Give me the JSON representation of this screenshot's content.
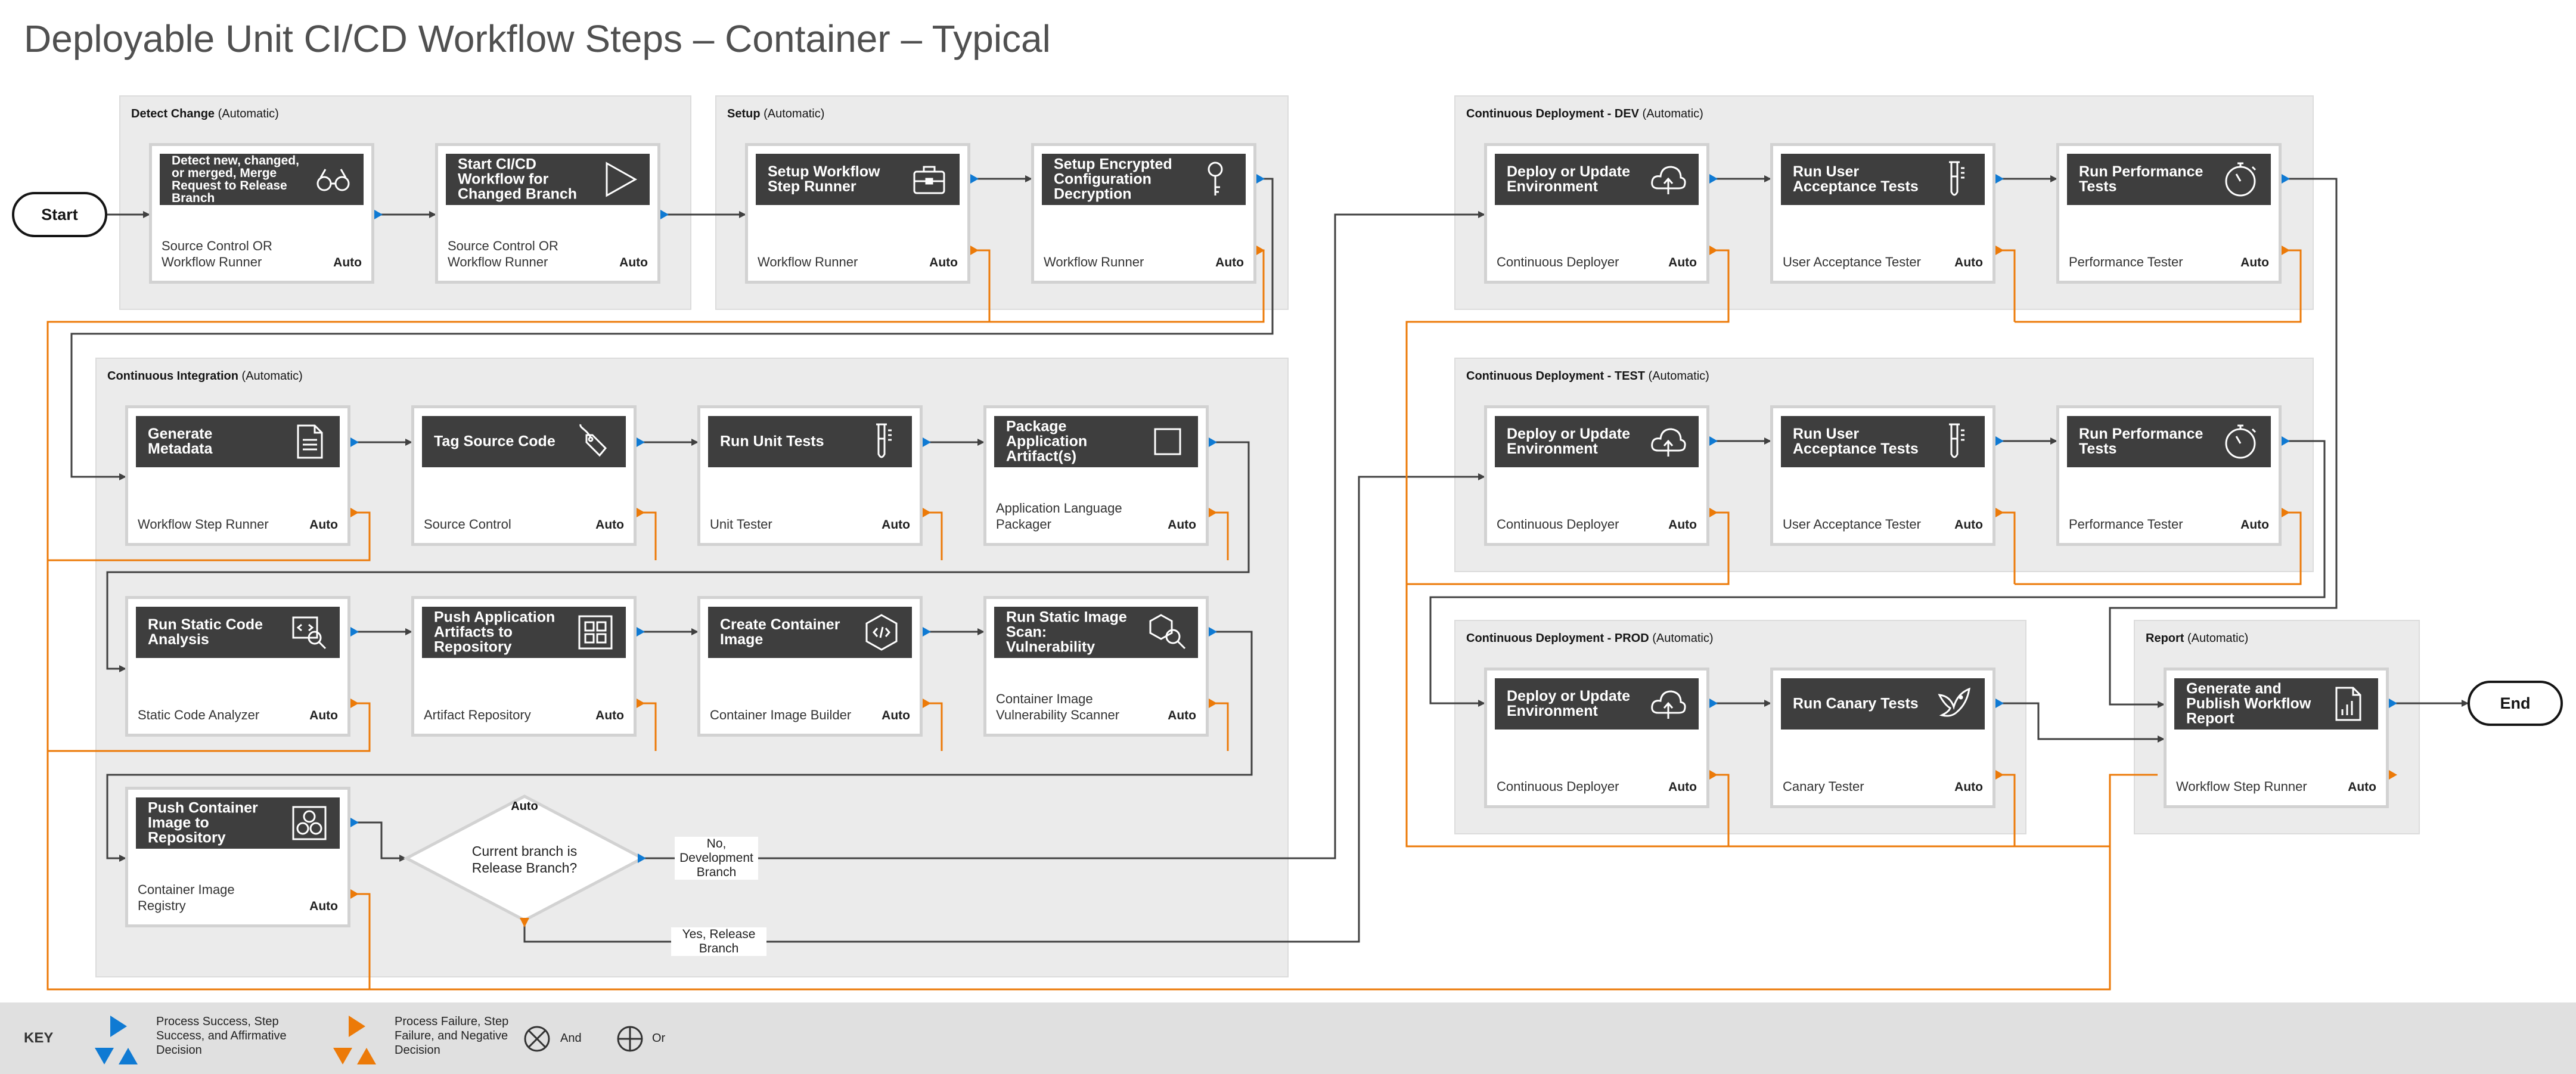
{
  "title": "Deployable Unit CI/CD Workflow Steps – Container – Typical",
  "colors": {
    "success": "#0f7ad3",
    "failure": "#ec7a08",
    "wire": "#404040",
    "panel": "#ebebeb"
  },
  "groups": {
    "detect": {
      "label": "Detect Change",
      "suffix": " (Automatic)"
    },
    "setup": {
      "label": "Setup",
      "suffix": " (Automatic)"
    },
    "ci": {
      "label": "Continuous Integration",
      "suffix": " (Automatic)"
    },
    "cd_dev": {
      "label": "Continuous Deployment - DEV",
      "suffix": " (Automatic)"
    },
    "cd_test": {
      "label": "Continuous Deployment - TEST",
      "suffix": " (Automatic)"
    },
    "cd_prod": {
      "label": "Continuous Deployment - PROD",
      "suffix": " (Automatic)"
    },
    "report": {
      "label": "Report",
      "suffix": " (Automatic)"
    }
  },
  "auto": "Auto",
  "steps": {
    "detect1": {
      "title": "Detect new, changed, or merged, Merge Request to Release Branch",
      "role": "Source Control OR Workflow Runner",
      "icon": "binoculars-icon"
    },
    "detect2": {
      "title": "Start CI/CD Workflow for Changed Branch",
      "role": "Source Control OR Workflow Runner",
      "icon": "play-icon"
    },
    "setup1": {
      "title": "Setup Workflow Step Runner",
      "role": "Workflow Runner",
      "icon": "toolbox-icon"
    },
    "setup2": {
      "title": "Setup Encrypted Configuration Decryption",
      "role": "Workflow Runner",
      "icon": "key-icon"
    },
    "ci1": {
      "title": "Generate Metadata",
      "role": "Workflow Step Runner",
      "icon": "document-icon"
    },
    "ci2": {
      "title": "Tag Source Code",
      "role": "Source Control",
      "icon": "tag-icon"
    },
    "ci3": {
      "title": "Run Unit Tests",
      "role": "Unit Tester",
      "icon": "test-tube-icon"
    },
    "ci4": {
      "title": "Package Application Artifact(s)",
      "role": "Application Language Packager",
      "icon": "package-icon"
    },
    "ci5": {
      "title": "Run Static Code Analysis",
      "role": "Static Code Analyzer",
      "icon": "code-search-icon"
    },
    "ci6": {
      "title": "Push Application Artifacts to Repository",
      "role": "Artifact Repository",
      "icon": "repository-icon"
    },
    "ci7": {
      "title": "Create Container Image",
      "role": "Container Image Builder",
      "icon": "container-hex-icon"
    },
    "ci8": {
      "title": "Run Static Image Scan: Vulnerability",
      "role": "Container Image Vulnerability Scanner",
      "icon": "image-scan-icon"
    },
    "ci9": {
      "title": "Push Container Image to Repository",
      "role": "Container Image Registry",
      "icon": "registry-icon"
    },
    "dev1": {
      "title": "Deploy or Update Environment",
      "role": "Continuous Deployer",
      "icon": "cloud-upload-icon"
    },
    "dev2": {
      "title": "Run User Acceptance Tests",
      "role": "User Acceptance Tester",
      "icon": "test-tube-icon"
    },
    "dev3": {
      "title": "Run Performance Tests",
      "role": "Performance Tester",
      "icon": "stopwatch-icon"
    },
    "test1": {
      "title": "Deploy or Update Environment",
      "role": "Continuous Deployer",
      "icon": "cloud-upload-icon"
    },
    "test2": {
      "title": "Run User Acceptance Tests",
      "role": "User Acceptance Tester",
      "icon": "test-tube-icon"
    },
    "test3": {
      "title": "Run Performance Tests",
      "role": "Performance Tester",
      "icon": "stopwatch-icon"
    },
    "prod1": {
      "title": "Deploy or Update Environment",
      "role": "Continuous Deployer",
      "icon": "cloud-upload-icon"
    },
    "prod2": {
      "title": "Run Canary Tests",
      "role": "Canary Tester",
      "icon": "bird-icon"
    },
    "report1": {
      "title": "Generate and Publish Workflow Report",
      "role": "Workflow Step Runner",
      "icon": "report-icon"
    }
  },
  "terminals": {
    "start": "Start",
    "end": "End"
  },
  "decision": {
    "question": "Current branch is Release Branch?",
    "auto": "Auto",
    "no_label": "No, Development Branch",
    "yes_label": "Yes, Release Branch"
  },
  "key": {
    "heading": "KEY",
    "success": "Process Success, Step Success, and Affirmative Decision",
    "failure": "Process Failure, Step Failure, and Negative Decision",
    "and": "And",
    "or": "Or"
  }
}
